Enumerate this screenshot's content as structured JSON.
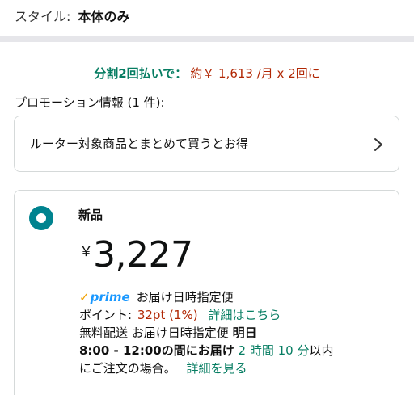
{
  "style_row": {
    "label": "スタイル:",
    "value": "本体のみ"
  },
  "installment": {
    "label": "分割2回払いで：",
    "value": "約￥ 1,613 /月 x 2回に"
  },
  "promotions": {
    "heading": "プロモーション情報 (1 件):",
    "card_text": "ルーター対象商品とまとめて買うとお得",
    "chevron_icon": "chevron-right-icon"
  },
  "offer": {
    "condition": "新品",
    "price_currency": "￥",
    "price_amount": "3,227",
    "prime_check": "✓",
    "prime_label": "prime",
    "delivery_type": "お届け日時指定便",
    "points_label": "ポイント:",
    "points_value": "32pt (1%)",
    "points_link": "詳細はこちら",
    "shipping_prefix": "無料配送 お届け日時指定便",
    "shipping_day": "明日",
    "time_window": "8:00 - 12:00の間にお届け",
    "countdown": "2 時間 10 分",
    "countdown_suffix": "以内",
    "order_note": "にご注文の場合。",
    "details_link": "詳細を見る"
  },
  "colors": {
    "accent_green": "#067d62",
    "price_red": "#b12704",
    "radio_teal": "#00838f",
    "prime_blue": "#1a98ff",
    "prime_check": "#f0a000"
  }
}
